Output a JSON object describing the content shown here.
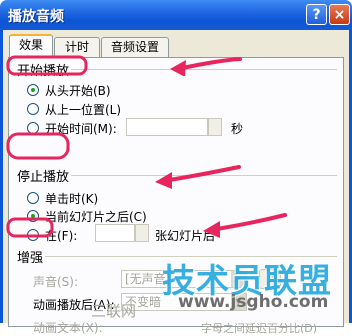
{
  "window": {
    "title": "播放音频",
    "help_glyph": "?",
    "close_glyph": "×"
  },
  "tabs": [
    {
      "label": "效果",
      "active": true
    },
    {
      "label": "计时",
      "active": false
    },
    {
      "label": "音频设置",
      "active": false
    }
  ],
  "start_group": {
    "label": "开始播放",
    "options": [
      {
        "label": "从头开始(B)",
        "selected": true
      },
      {
        "label": "从上一位置(L)",
        "selected": false
      },
      {
        "label": "开始时间(M):",
        "selected": false
      }
    ],
    "time_unit": "秒"
  },
  "stop_group": {
    "label": "停止播放",
    "options": [
      {
        "label": "单击时(K)",
        "selected": false
      },
      {
        "label": "当前幻灯片之后(C)",
        "selected": true
      },
      {
        "label": "在(F):",
        "selected": false
      }
    ],
    "after_slides_suffix": "张幻灯片后"
  },
  "enhance_group": {
    "label": "增强",
    "sound_label": "声音(S):",
    "sound_value": "[无声音]",
    "after_anim_label": "动画播放后(A):",
    "after_anim_value": "不变暗",
    "anim_text_label": "动画文本(X):",
    "partial_text": "字母之间延迟百分比(D)",
    "partial_left": "三联网"
  },
  "watermark": {
    "brand": "技术员联盟",
    "url": "www.jsgho.com"
  },
  "colors": {
    "title_bar": "#1c64e0",
    "arrow": "#e8265e",
    "dialog_bg": "#ece9d8",
    "watermark": "#22a7de"
  }
}
